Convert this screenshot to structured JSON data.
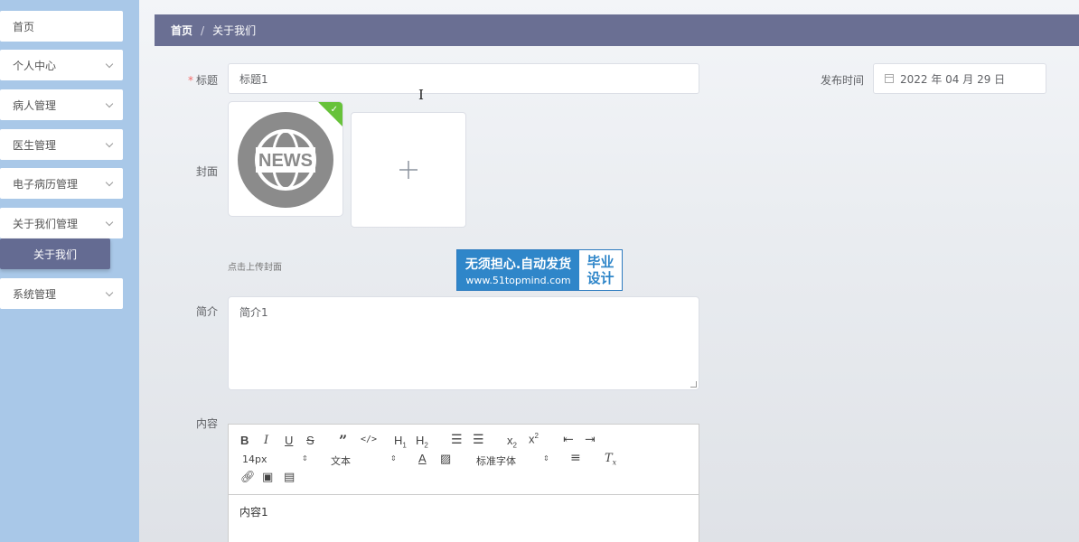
{
  "sidebar": {
    "items": [
      {
        "label": "首页",
        "has_chevron": false
      },
      {
        "label": "个人中心",
        "has_chevron": true
      },
      {
        "label": "病人管理",
        "has_chevron": true
      },
      {
        "label": "医生管理",
        "has_chevron": true
      },
      {
        "label": "电子病历管理",
        "has_chevron": true
      },
      {
        "label": "关于我们管理",
        "has_chevron": true
      },
      {
        "label": "系统管理",
        "has_chevron": true
      }
    ],
    "active_sub": "关于我们"
  },
  "breadcrumb": {
    "home": "首页",
    "separator": "/",
    "current": "关于我们"
  },
  "form": {
    "title_label": "标题",
    "title_value": "标题1",
    "publish_label": "发布时间",
    "publish_value": "2022 年 04 月 29 日",
    "cover_label": "封面",
    "cover_hint": "点击上传封面",
    "cover_image_text": "NEWS",
    "intro_label": "简介",
    "intro_value": "简介1",
    "content_label": "内容",
    "content_value": "内容1"
  },
  "editor_toolbar": {
    "font_size": "14px",
    "text_style": "文本",
    "font_family": "标准字体"
  },
  "watermark": {
    "line1": "无须担心.自动发货",
    "line2": "www.51topmind.com",
    "right1": "毕业",
    "right2": "设计"
  },
  "colors": {
    "sidebar_bg": "#a9c8e8",
    "breadcrumb_bg": "#6a6f93",
    "active_sub_bg": "#646b92",
    "success_green": "#67c23a"
  }
}
